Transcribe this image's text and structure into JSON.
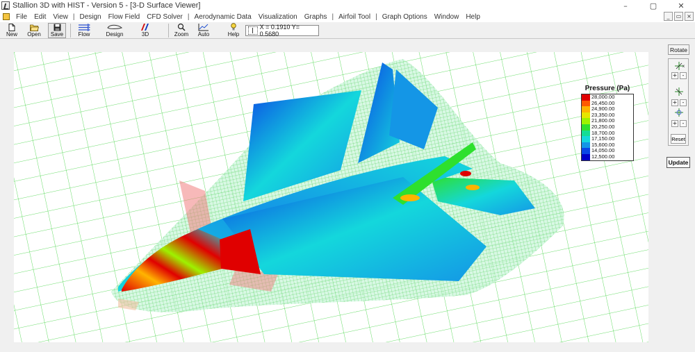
{
  "window": {
    "title": "Stallion 3D with HIST - Version 5 - [3-D Surface Viewer]",
    "controls": {
      "minimize": "–",
      "maximize": "▢",
      "close": "✕"
    },
    "mdi_controls": {
      "minimize": "_",
      "restore": "▭",
      "close": "×"
    }
  },
  "menu": {
    "items": [
      "File",
      "Edit",
      "View",
      "|",
      "Design",
      "Flow Field",
      "CFD Solver",
      "|",
      "Aerodynamic Data",
      "Visualization",
      "Graphs",
      "|",
      "Airfoil Tool",
      "|",
      "Graph Options",
      "Window",
      "Help"
    ]
  },
  "toolbar": {
    "new": "New",
    "open": "Open",
    "save": "Save",
    "flow": "Flow",
    "design": "Design",
    "view3d": "3D",
    "zoom": "Zoom",
    "auto": "Auto",
    "help": "Help",
    "coords": "X = 0.1910  Y= 0.5680"
  },
  "legend": {
    "title": "Pressure (Pa)",
    "labels": [
      "28,000.00",
      "26,450.00",
      "24,900.00",
      "23,350.00",
      "21,800.00",
      "20,250.00",
      "18,700.00",
      "17,150.00",
      "15,600.00",
      "14,050.00",
      "12,500.00"
    ],
    "colors": [
      "#e00000",
      "#ff5a00",
      "#ffb400",
      "#e6e600",
      "#9ef200",
      "#2ee02e",
      "#14dc96",
      "#14d7dc",
      "#1496e6",
      "#0a46e6",
      "#0000c8"
    ]
  },
  "side_panel": {
    "rotate": "Rotate",
    "axis_x_label": "x",
    "plus": "+",
    "minus": "-",
    "reset": "Reset",
    "update": "Update"
  },
  "colors": {
    "grid": "#3cd23c",
    "background": "#ffffff"
  }
}
